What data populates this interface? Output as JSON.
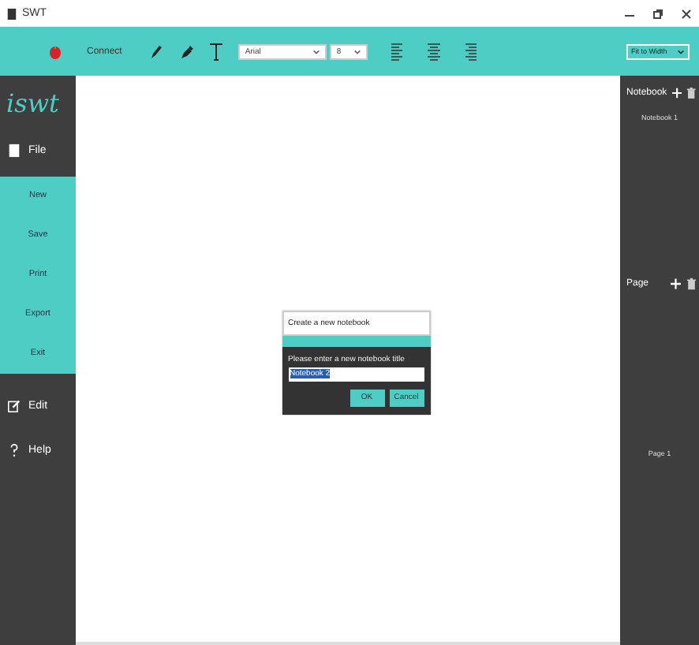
{
  "window": {
    "title": "SWT"
  },
  "toolbar": {
    "connect": "Connect",
    "font": "Arial",
    "size": "8",
    "zoom": "Fit to Width"
  },
  "sidebar": {
    "logo": "iswt",
    "menus": [
      {
        "kind": "menu",
        "label": "File",
        "items": [
          "New",
          "Save",
          "Print",
          "Export",
          "Exit"
        ]
      },
      {
        "kind": "menu",
        "label": "Edit"
      },
      {
        "kind": "menu",
        "label": "Help"
      }
    ]
  },
  "dialog": {
    "title": "Create a new notebook",
    "prompt": "Please enter a new notebook title",
    "value": "Notebook 2",
    "buttons": [
      "OK",
      "Cancel"
    ]
  },
  "right_panel": {
    "notebook_label": "Notebook",
    "notebooks": [
      "Notebook 1"
    ],
    "page_label": "Page",
    "pages": [
      "Page 1"
    ]
  }
}
